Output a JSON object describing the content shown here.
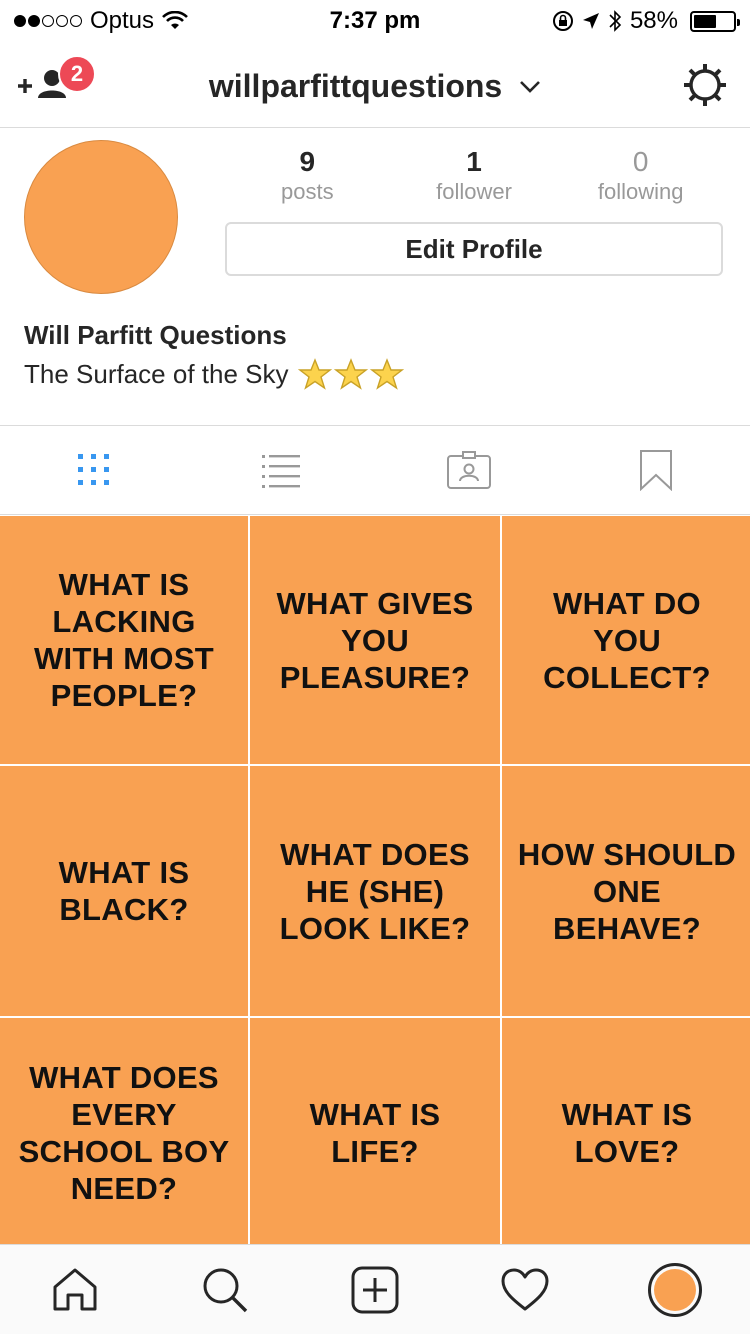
{
  "status_bar": {
    "signal_bars_filled": 2,
    "signal_bars_total": 5,
    "carrier": "Optus",
    "time": "7:37 pm",
    "battery": "58%",
    "battery_level": 0.58
  },
  "header": {
    "notification_count": "2",
    "username": "willparfittquestions"
  },
  "profile": {
    "stats": [
      {
        "value": "9",
        "label": "posts"
      },
      {
        "value": "1",
        "label": "follower"
      },
      {
        "value": "0",
        "label": "following"
      }
    ],
    "edit_label": "Edit Profile",
    "full_name": "Will Parfitt Questions",
    "bio": "The Surface of the Sky",
    "bio_stars": 3
  },
  "tabs": [
    "grid-view",
    "list-view",
    "tagged",
    "saved"
  ],
  "posts": [
    "WHAT IS LACKING WITH MOST PEOPLE?",
    "WHAT GIVES YOU PLEASURE?",
    "WHAT DO YOU COLLECT?",
    "WHAT IS BLACK?",
    "WHAT DOES HE (SHE) LOOK LIKE?",
    "HOW SHOULD ONE BEHAVE?",
    "WHAT DOES EVERY SCHOOL BOY NEED?",
    "WHAT IS LIFE?",
    "WHAT IS LOVE?"
  ],
  "colors": {
    "tile": "#f9a152",
    "accent": "#3897f0",
    "badge": "#ed4956"
  },
  "bottom_nav": [
    "home",
    "search",
    "new-post",
    "activity",
    "profile"
  ]
}
